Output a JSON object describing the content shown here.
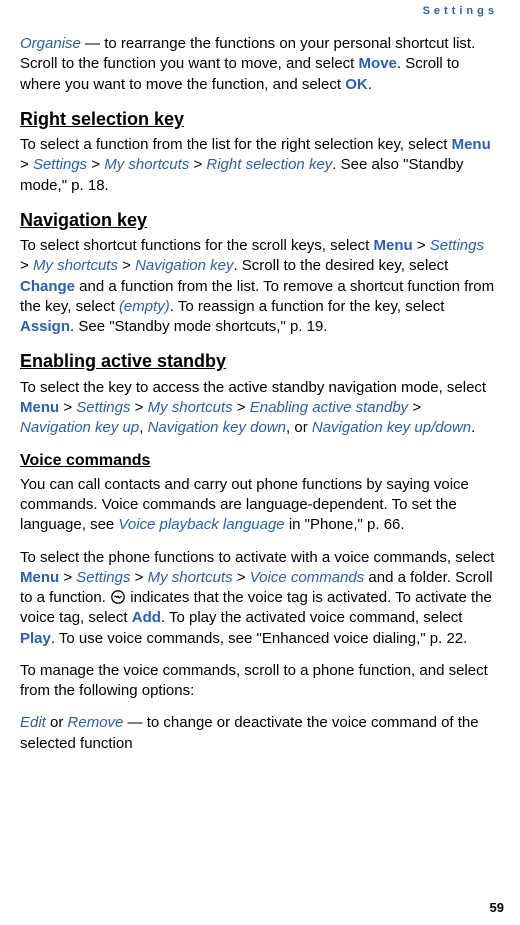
{
  "header": {
    "section": "Settings"
  },
  "page_number": "59",
  "intro": {
    "organise": "Organise",
    "intro_t1": " — to rearrange the functions on your personal shortcut list. Scroll to the function you want to move, and select ",
    "move": "Move",
    "intro_t2": ". Scroll to where you want to move the function, and select ",
    "ok": "OK",
    "intro_t3": "."
  },
  "rsk": {
    "heading": "Right selection key",
    "t1": "To select a function from the list for the right selection key, select ",
    "menu": "Menu",
    "settings": "Settings",
    "myshortcuts": "My shortcuts",
    "rskey": "Right selection key",
    "t2": ". See also \"Standby mode,\" p. 18."
  },
  "nav": {
    "heading": "Navigation key",
    "t1": "To select shortcut functions for the scroll keys, select ",
    "menu": "Menu",
    "settings": "Settings",
    "myshortcuts": "My shortcuts",
    "navkey": "Navigation key",
    "t2": ". Scroll to the desired key, select ",
    "change": "Change",
    "t3": " and a function from the list. To remove a shortcut function from the key, select ",
    "empty": "(empty)",
    "t4": ". To reassign a function for the key, select ",
    "assign": "Assign",
    "t5": ". See \"Standby mode shortcuts,\" p. 19."
  },
  "eas": {
    "heading": "Enabling active standby",
    "t1": "To select the key to access the active standby navigation mode, select ",
    "menu": "Menu",
    "settings": "Settings",
    "myshortcuts": "My shortcuts",
    "eas": "Enabling active standby",
    "up": "Navigation key up",
    "down": "Navigation key down",
    "updown": "Navigation key up/down",
    "comma": ", ",
    "or": ", or ",
    "period": "."
  },
  "voice": {
    "heading": "Voice commands",
    "p1_t1": "You can call contacts and carry out phone functions by saying voice commands. Voice commands are language-dependent. To set the language, see ",
    "vpl": "Voice playback language",
    "p1_t2": " in \"Phone,\" p. 66.",
    "p2_t1": "To select the phone functions to activate with a voice commands, select ",
    "menu": "Menu",
    "settings": "Settings",
    "myshortcuts": "My shortcuts",
    "vc": "Voice commands",
    "p2_t2": " and a folder. Scroll to a function. ",
    "p2_t3": " indicates that the voice tag is activated. To activate the voice tag, select ",
    "add": "Add",
    "p2_t4": ". To play the activated voice command, select ",
    "play": "Play",
    "p2_t5": ". To use voice commands, see \"Enhanced voice dialing,\" p. 22.",
    "p3": "To manage the voice commands, scroll to a phone function, and select from the following options:",
    "edit": "Edit",
    "or": " or ",
    "remove": "Remove",
    "p4_t1": " — to change or deactivate the voice command of the selected function"
  },
  "sep": {
    "gt": " > "
  }
}
